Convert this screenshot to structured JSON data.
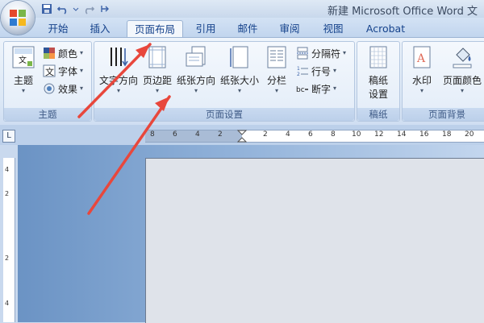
{
  "title_bar": {
    "title": "新建 Microsoft Office Word 文"
  },
  "tabs": [
    {
      "label": "开始"
    },
    {
      "label": "插入"
    },
    {
      "label": "页面布局",
      "active": true
    },
    {
      "label": "引用"
    },
    {
      "label": "邮件"
    },
    {
      "label": "审阅"
    },
    {
      "label": "视图"
    },
    {
      "label": "Acrobat"
    }
  ],
  "ribbon": {
    "themes": {
      "label": "主题",
      "themes_button": "主题",
      "colors": "颜色",
      "fonts": "字体",
      "effects": "效果"
    },
    "page_setup": {
      "label": "页面设置",
      "text_direction": "文字方向",
      "margins": "页边距",
      "orientation": "纸张方向",
      "size": "纸张大小",
      "columns": "分栏",
      "breaks": "分隔符",
      "line_numbers": "行号",
      "hyphenation": "断字"
    },
    "manuscript": {
      "label": "稿纸",
      "settings_line1": "稿纸",
      "settings_line2": "设置"
    },
    "page_background": {
      "label": "页面背景",
      "watermark": "水印",
      "page_color": "页面颜色"
    }
  },
  "ruler": {
    "ticks": [
      "8",
      "6",
      "4",
      "2",
      "2",
      "4",
      "6",
      "8",
      "10",
      "12",
      "14",
      "16",
      "18",
      "20"
    ],
    "vticks": [
      "4",
      "2",
      "2",
      "4"
    ]
  },
  "colors": {
    "annotation_arrow": "#e8473c",
    "accent": "#15428b"
  }
}
